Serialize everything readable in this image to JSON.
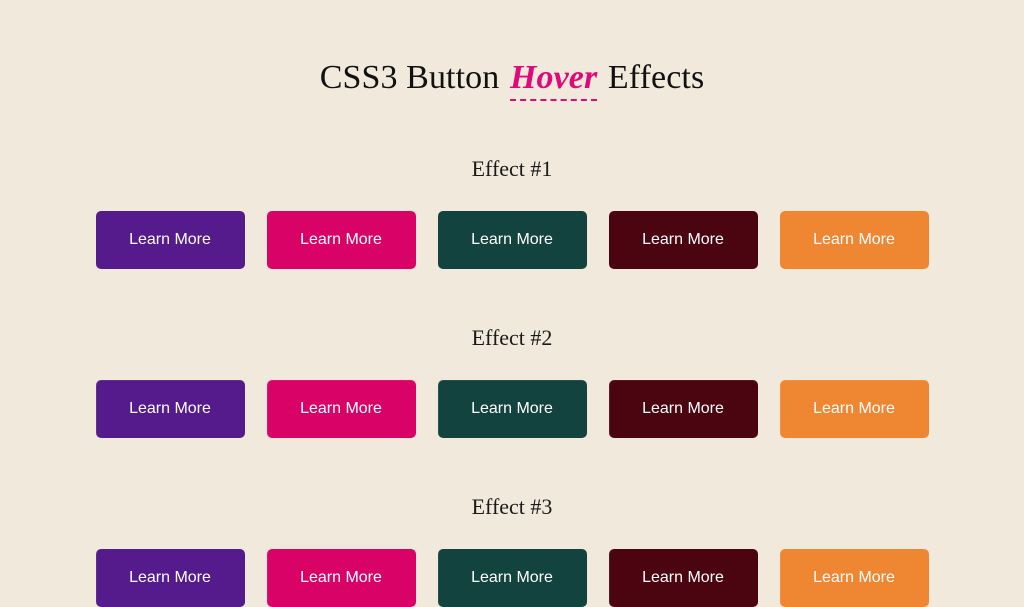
{
  "page": {
    "background_color": "#f0e9dc",
    "title_parts": {
      "before": "CSS3 Button ",
      "highlight": "Hover",
      "after": " Effects"
    },
    "title_highlight_color": "#e0097a",
    "title_text_color": "#111111"
  },
  "sections": [
    {
      "heading": "Effect #1",
      "buttons": [
        {
          "label": "Learn More",
          "color": "#551a8b"
        },
        {
          "label": "Learn More",
          "color": "#d90368"
        },
        {
          "label": "Learn More",
          "color": "#12433f"
        },
        {
          "label": "Learn More",
          "color": "#4a0511"
        },
        {
          "label": "Learn More",
          "color": "#ef8732"
        }
      ]
    },
    {
      "heading": "Effect #2",
      "buttons": [
        {
          "label": "Learn More",
          "color": "#551a8b"
        },
        {
          "label": "Learn More",
          "color": "#d90368"
        },
        {
          "label": "Learn More",
          "color": "#12433f"
        },
        {
          "label": "Learn More",
          "color": "#4a0511"
        },
        {
          "label": "Learn More",
          "color": "#ef8732"
        }
      ]
    },
    {
      "heading": "Effect #3",
      "buttons": [
        {
          "label": "Learn More",
          "color": "#551a8b"
        },
        {
          "label": "Learn More",
          "color": "#d90368"
        },
        {
          "label": "Learn More",
          "color": "#12433f"
        },
        {
          "label": "Learn More",
          "color": "#4a0511"
        },
        {
          "label": "Learn More",
          "color": "#ef8732"
        }
      ]
    }
  ],
  "palette": {
    "purple": "#551a8b",
    "pink": "#d90368",
    "teal": "#12433f",
    "maroon": "#4a0511",
    "orange": "#ef8732",
    "button_text": "#ffffff"
  }
}
